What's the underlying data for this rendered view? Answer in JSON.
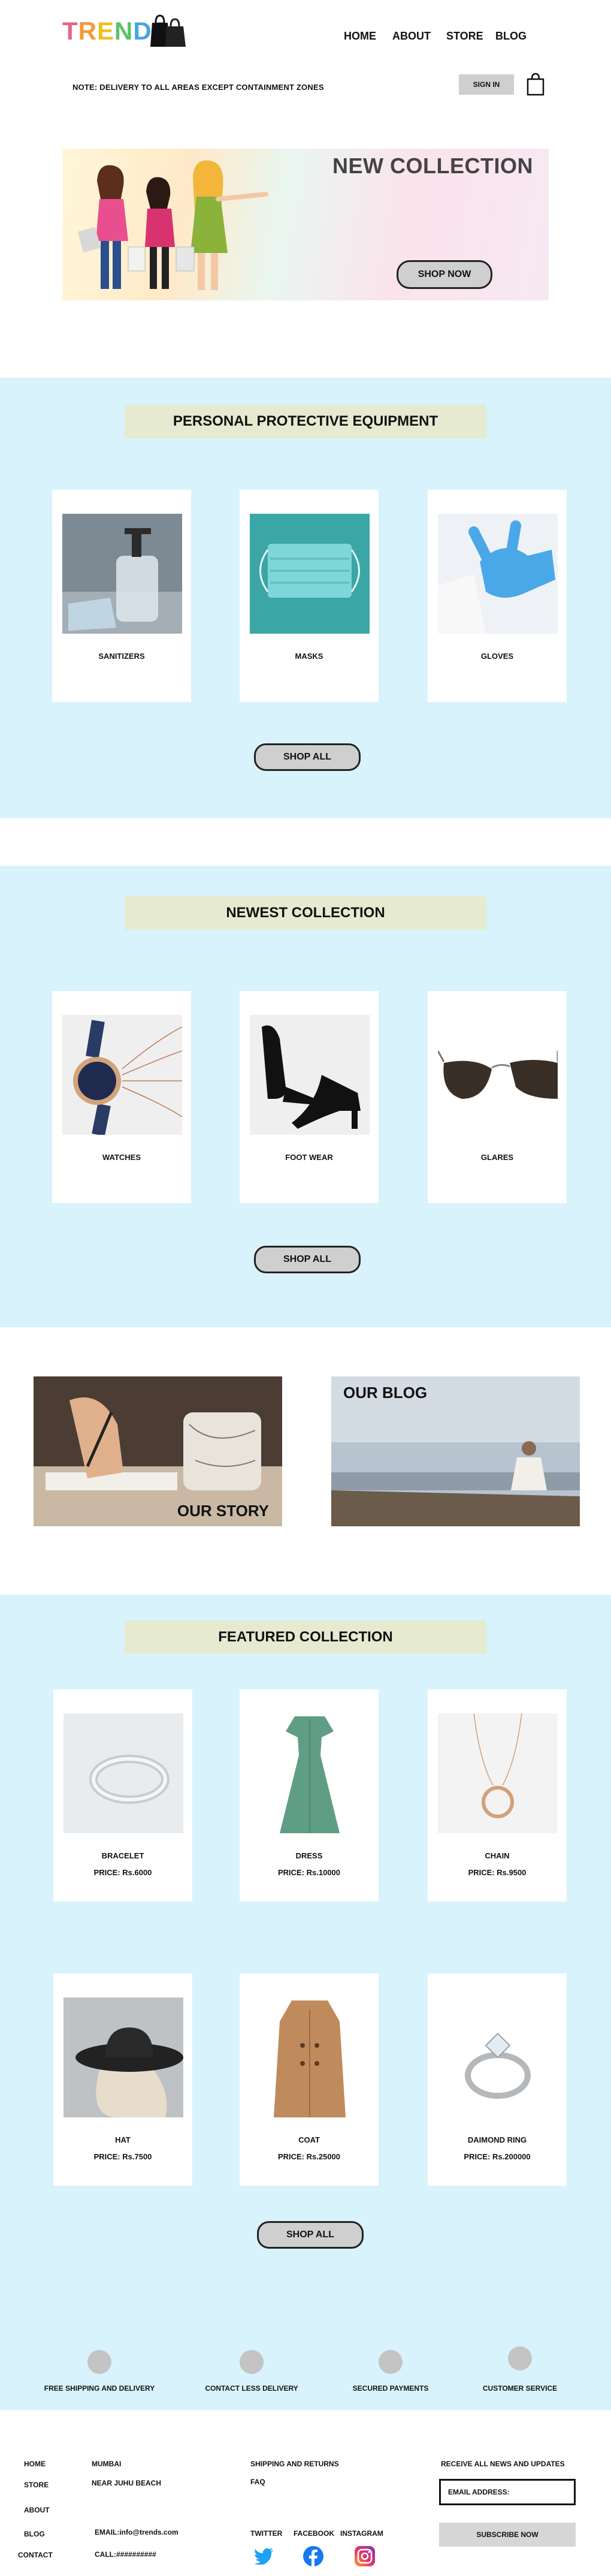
{
  "header": {
    "logo_text": "TRENDS",
    "nav": [
      "HOME",
      "ABOUT",
      "STORE",
      "BLOG"
    ],
    "note": "NOTE:  DELIVERY TO ALL AREAS EXCEPT CONTAINMENT ZONES",
    "signin_label": "SIGN IN"
  },
  "hero": {
    "title": "NEW COLLECTION",
    "button": "SHOP NOW"
  },
  "ppe": {
    "title": "PERSONAL PROTECTIVE EQUIPMENT",
    "items": [
      {
        "label": "SANITIZERS"
      },
      {
        "label": "MASKS"
      },
      {
        "label": "GLOVES"
      }
    ],
    "button": "SHOP ALL"
  },
  "newest": {
    "title": "NEWEST COLLECTION",
    "items": [
      {
        "label": "WATCHES"
      },
      {
        "label": "FOOT WEAR"
      },
      {
        "label": "GLARES"
      }
    ],
    "button": "SHOP ALL"
  },
  "promo": {
    "story": "OUR STORY",
    "blog": "OUR BLOG"
  },
  "featured": {
    "title": "FEATURED  COLLECTION",
    "items": [
      {
        "label": "BRACELET",
        "price": "PRICE: Rs.6000"
      },
      {
        "label": "DRESS",
        "price": "PRICE: Rs.10000"
      },
      {
        "label": "CHAIN",
        "price": "PRICE: Rs.9500"
      },
      {
        "label": "HAT",
        "price": "PRICE: Rs.7500"
      },
      {
        "label": "COAT",
        "price": "PRICE: Rs.25000"
      },
      {
        "label": "DAIMOND RING",
        "price": "PRICE: Rs.200000"
      }
    ],
    "button": "SHOP ALL"
  },
  "features": [
    "FREE SHIPPING AND DELIVERY",
    "CONTACT LESS DELIVERY",
    "SECURED PAYMENTS",
    "CUSTOMER SERVICE"
  ],
  "footer": {
    "links": [
      "HOME",
      "STORE",
      "ABOUT",
      "BLOG",
      "CONTACT"
    ],
    "address": [
      "MUMBAI",
      "NEAR JUHU BEACH"
    ],
    "email": "EMAIL:info@trends.com",
    "call": "CALL:##########",
    "help": [
      "SHIPPING AND RETURNS",
      "FAQ"
    ],
    "social": [
      "TWITTER",
      "FACEBOOK",
      "INSTAGRAM"
    ],
    "newsletter_title": "RECEIVE ALL NEWS AND UPDATES",
    "email_placeholder": "EMAIL ADDRESS:",
    "subscribe": "SUBSCRIBE NOW"
  },
  "colors": {
    "band": "#d8f3fb",
    "title_bg": "#e6ead0",
    "button_bg": "#cfcfcf"
  }
}
